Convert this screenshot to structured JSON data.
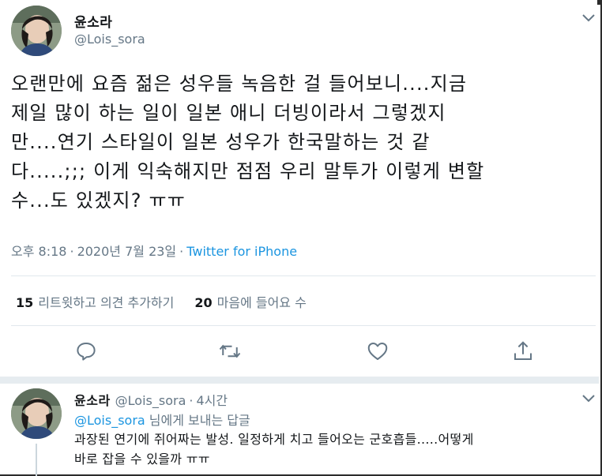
{
  "tweet": {
    "display_name": "윤소라",
    "handle": "@Lois_sora",
    "text": "오랜만에 요즘 젊은 성우들 녹음한 걸 들어보니....지금\n제일 많이 하는 일이 일본 애니 더빙이라서 그렇겠지\n만....연기 스타일이 일본 성우가 한국말하는 것 같\n다.....;;; 이게 익숙해지만 점점 우리 말투가 이렇게 변할\n수...도 있겠지? ㅠㅠ",
    "time": "오후 8:18",
    "date": "2020년 7월 23일",
    "separator": "·",
    "source": "Twitter for iPhone",
    "retweets_count": "15",
    "retweets_label": "리트윗하고 의견 추가하기",
    "likes_count": "20",
    "likes_label": "마음에 들어요 수"
  },
  "actions": {
    "reply_icon": "reply-icon",
    "retweet_icon": "retweet-icon",
    "like_icon": "heart-icon",
    "share_icon": "share-icon"
  },
  "reply": {
    "display_name": "윤소라",
    "handle": "@Lois_sora",
    "separator": "·",
    "age": "4시간",
    "mention": "@Lois_sora",
    "reply_suffix": " 님에게 보내는 답글",
    "text": "과장된 연기에 쥐어짜는 발성. 일정하게 치고 들어오는 군호흡들.....어떻게\n바로 잡을 수 있을까 ㅠㅠ"
  },
  "colors": {
    "accent": "#1b95e0",
    "muted": "#657786",
    "text": "#14171a",
    "divider": "#e1e8ed"
  }
}
